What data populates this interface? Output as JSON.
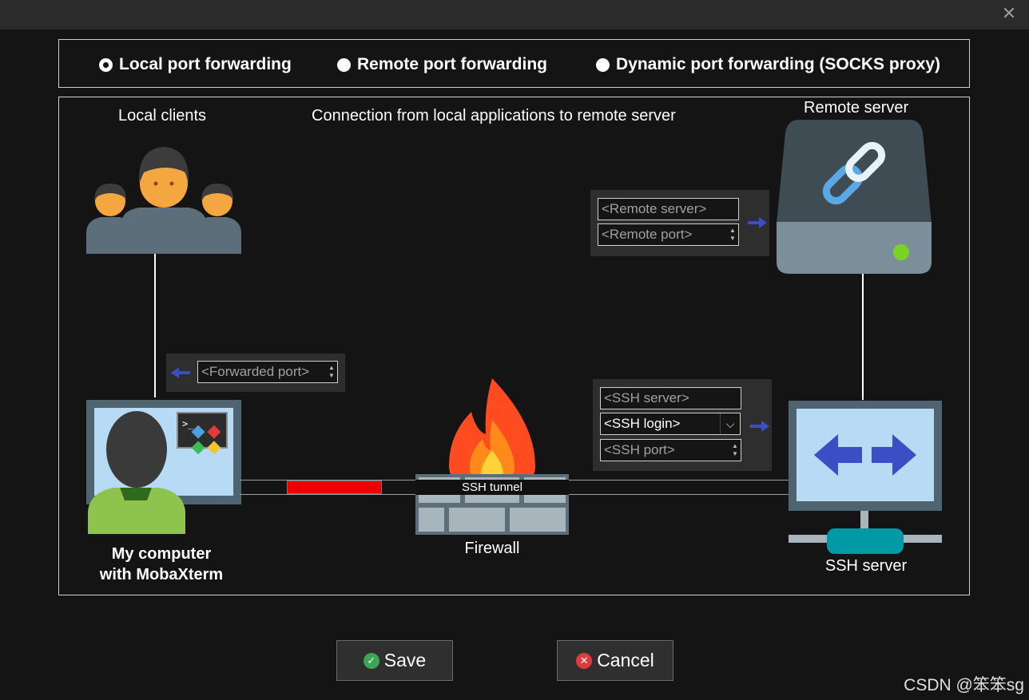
{
  "window": {
    "close_glyph": "✕"
  },
  "modes": [
    {
      "label": "Local port forwarding",
      "selected": true
    },
    {
      "label": "Remote port forwarding",
      "selected": false
    },
    {
      "label": "Dynamic port forwarding (SOCKS proxy)",
      "selected": false
    }
  ],
  "diagram": {
    "local_clients": "Local clients",
    "caption": "Connection from local applications to remote server",
    "remote_server": "Remote server",
    "my_computer": [
      "My computer",
      "with MobaXterm"
    ],
    "firewall": "Firewall",
    "ssh_server": "SSH server",
    "tunnel": "SSH tunnel"
  },
  "fields": {
    "remote_server": "<Remote server>",
    "remote_port": "<Remote port>",
    "forwarded_port": "<Forwarded port>",
    "ssh_server": "<SSH server>",
    "ssh_login": "<SSH login>",
    "ssh_port": "<SSH port>"
  },
  "buttons": {
    "save": "Save",
    "cancel": "Cancel"
  },
  "watermark": "CSDN @笨笨sg",
  "colors": {
    "accent_arrow": "#3a4fc6",
    "tunnel_progress": "#ee0000",
    "save_icon": "#3aa757",
    "cancel_icon": "#e03b3b",
    "server_led": "#7bd321"
  }
}
